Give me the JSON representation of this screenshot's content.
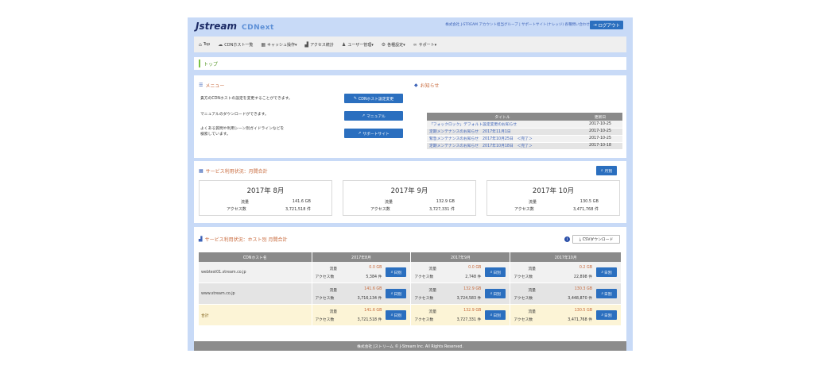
{
  "header": {
    "logo_main": "Jstream",
    "logo_sub": "CDNext",
    "account_links": "株式会社 J-STREAM アカウント担当グループ | サポートサイト(ナレッジ) 各種問い合わせ",
    "logout_label": "ログアウト"
  },
  "nav": {
    "items": [
      {
        "label": "Top"
      },
      {
        "label": "CDNホスト一覧"
      },
      {
        "label": "キャッシュ操作▾"
      },
      {
        "label": "アクセス統計"
      },
      {
        "label": "ユーザー管理▾"
      },
      {
        "label": "各種設定▾"
      },
      {
        "label": "サポート▾"
      }
    ]
  },
  "breadcrumb": {
    "label": "トップ"
  },
  "menu": {
    "title": "メニュー",
    "line1": "貴方のCDNホストの設定を変更することができます。",
    "line2": "マニュアルのダウンロードができます。",
    "line3a": "よくある質問や利用シーン別ガイドラインなどを",
    "line3b": "検索しています。",
    "btn_cdn": "CDNホスト設定変更",
    "btn_manual": "マニュアル",
    "btn_support": "サポートサイト"
  },
  "notice": {
    "title": "お知らせ",
    "col_title": "タイトル",
    "col_date": "更新日",
    "rows": [
      {
        "title": "「フォックロック」デフォルト設定変更のお知らせ",
        "date": "2017-10-25"
      },
      {
        "title": "定期メンテナンスのお知らせ　2017年11月1日",
        "date": "2017-10-25"
      },
      {
        "title": "緊急メンテナンスのお知らせ　2017年10月25日　＜完了＞",
        "date": "2017-10-25"
      },
      {
        "title": "定期メンテナンスのお知らせ　2017年10月18日　＜完了＞",
        "date": "2017-10-18"
      }
    ]
  },
  "monthly": {
    "title": "サービス利用状況：月間合計",
    "btn_label": "月別",
    "traffic_label": "流量",
    "access_label": "アクセス数",
    "boxes": [
      {
        "month": "2017年 8月",
        "traffic": "141.6 GB",
        "access": "3,721,518 件"
      },
      {
        "month": "2017年 9月",
        "traffic": "132.9 GB",
        "access": "3,727,331 件"
      },
      {
        "month": "2017年 10月",
        "traffic": "130.5 GB",
        "access": "3,471,768 件"
      }
    ]
  },
  "host": {
    "title": "サービス利用状況：ホスト別 月間合計",
    "csv_label": "CSVダウンロード",
    "info_label": "i",
    "col_host": "CDNホスト名",
    "col_m1": "2017年8月",
    "col_m2": "2017年9月",
    "col_m3": "2017年10月",
    "traffic_label": "流量",
    "access_label": "アクセス数",
    "daily_label": "日別",
    "rows": [
      {
        "name": "webtest01.stream.co.jp",
        "c": [
          {
            "t": "0.0 GB",
            "a": "5,384 件"
          },
          {
            "t": "0.0 GB",
            "a": "2,748 件"
          },
          {
            "t": "0.2 GB",
            "a": "22,898 件"
          }
        ]
      },
      {
        "name": "www.stream.co.jp",
        "c": [
          {
            "t": "141.6 GB",
            "a": "3,716,134 件"
          },
          {
            "t": "132.9 GB",
            "a": "3,724,583 件"
          },
          {
            "t": "130.3 GB",
            "a": "3,448,870 件"
          }
        ]
      },
      {
        "name": "合計",
        "c": [
          {
            "t": "141.6 GB",
            "a": "3,721,518 件"
          },
          {
            "t": "132.9 GB",
            "a": "3,727,331 件"
          },
          {
            "t": "130.5 GB",
            "a": "3,471,768 件"
          }
        ]
      }
    ]
  },
  "footer": {
    "text": "株式会社 Jストリーム © J-Stream Inc. All Rights Reserved."
  }
}
